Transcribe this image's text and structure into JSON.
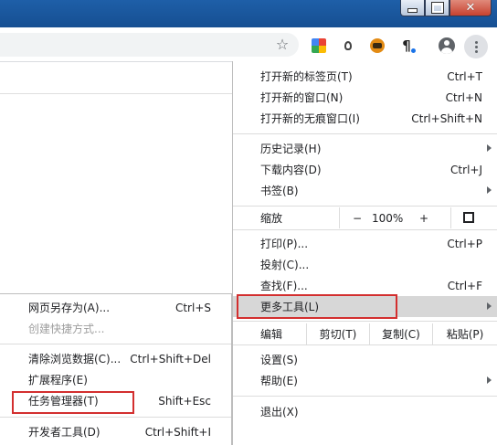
{
  "window": {
    "close_glyph": "✕"
  },
  "toolbar": {
    "star_icon": "☆",
    "ext_pilcrow": "¶"
  },
  "menu": {
    "new_tab": {
      "label": "打开新的标签页(T)",
      "shortcut": "Ctrl+T"
    },
    "new_window": {
      "label": "打开新的窗口(N)",
      "shortcut": "Ctrl+N"
    },
    "new_incognito": {
      "label": "打开新的无痕窗口(I)",
      "shortcut": "Ctrl+Shift+N"
    },
    "history": {
      "label": "历史记录(H)"
    },
    "downloads": {
      "label": "下载内容(D)",
      "shortcut": "Ctrl+J"
    },
    "bookmarks": {
      "label": "书签(B)"
    },
    "zoom": {
      "label": "缩放",
      "minus": "−",
      "value": "100%",
      "plus": "+"
    },
    "print": {
      "label": "打印(P)...",
      "shortcut": "Ctrl+P"
    },
    "cast": {
      "label": "投射(C)..."
    },
    "find": {
      "label": "查找(F)...",
      "shortcut": "Ctrl+F"
    },
    "more_tools": {
      "label": "更多工具(L)"
    },
    "edit": {
      "label": "编辑",
      "cut": "剪切(T)",
      "copy": "复制(C)",
      "paste": "粘贴(P)"
    },
    "settings": {
      "label": "设置(S)"
    },
    "help": {
      "label": "帮助(E)"
    },
    "exit": {
      "label": "退出(X)"
    }
  },
  "submenu": {
    "save_page": {
      "label": "网页另存为(A)...",
      "shortcut": "Ctrl+S"
    },
    "create_shortcut": {
      "label": "创建快捷方式..."
    },
    "clear_data": {
      "label": "清除浏览数据(C)...",
      "shortcut": "Ctrl+Shift+Del"
    },
    "extensions": {
      "label": "扩展程序(E)"
    },
    "task_manager": {
      "label": "任务管理器(T)",
      "shortcut": "Shift+Esc"
    },
    "dev_tools": {
      "label": "开发者工具(D)",
      "shortcut": "Ctrl+Shift+I"
    }
  },
  "colors": {
    "titlebar": "#1e5fa8",
    "highlight": "#d7d7d7",
    "annotation_red": "#d32f2f"
  }
}
